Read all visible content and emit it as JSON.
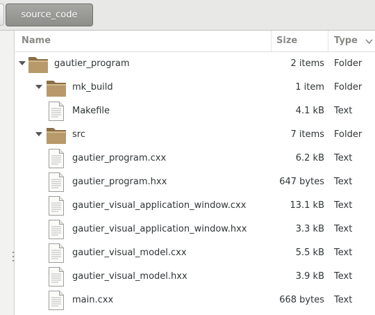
{
  "pathbar": {
    "crumb_label": "source_code"
  },
  "columns": {
    "name": "Name",
    "size": "Size",
    "type": "Type"
  },
  "sort": {
    "column": "Type",
    "indicator_icon": "chevron-down-icon"
  },
  "rows": [
    {
      "name": "gautier_program",
      "size": "2 items",
      "type": "Folder",
      "kind": "folder",
      "depth": 0,
      "expanded": true
    },
    {
      "name": "mk_build",
      "size": "1 item",
      "type": "Folder",
      "kind": "folder",
      "depth": 1,
      "expanded": true
    },
    {
      "name": "Makefile",
      "size": "4.1 kB",
      "type": "Text",
      "kind": "file",
      "depth": 2
    },
    {
      "name": "src",
      "size": "7 items",
      "type": "Folder",
      "kind": "folder",
      "depth": 1,
      "expanded": true
    },
    {
      "name": "gautier_program.cxx",
      "size": "6.2 kB",
      "type": "Text",
      "kind": "file",
      "depth": 2
    },
    {
      "name": "gautier_program.hxx",
      "size": "647 bytes",
      "type": "Text",
      "kind": "file",
      "depth": 2
    },
    {
      "name": "gautier_visual_application_window.cxx",
      "size": "13.1 kB",
      "type": "Text",
      "kind": "file",
      "depth": 2
    },
    {
      "name": "gautier_visual_application_window.hxx",
      "size": "3.3 kB",
      "type": "Text",
      "kind": "file",
      "depth": 2
    },
    {
      "name": "gautier_visual_model.cxx",
      "size": "5.5 kB",
      "type": "Text",
      "kind": "file",
      "depth": 2
    },
    {
      "name": "gautier_visual_model.hxx",
      "size": "3.9 kB",
      "type": "Text",
      "kind": "file",
      "depth": 2
    },
    {
      "name": "main.cxx",
      "size": "668 bytes",
      "type": "Text",
      "kind": "file",
      "depth": 2
    }
  ],
  "colors": {
    "folder": "#b89a6a",
    "folder_dark": "#8a6f45",
    "header_text": "#888a85",
    "text": "#2e3436"
  }
}
